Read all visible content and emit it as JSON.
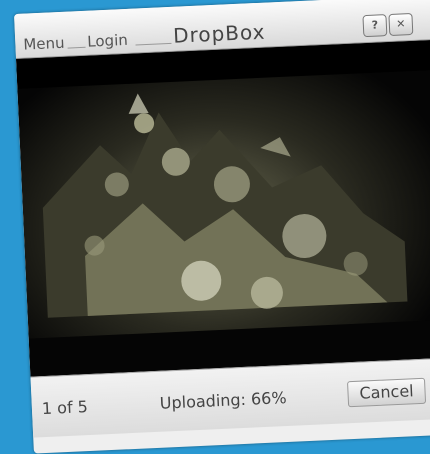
{
  "header": {
    "menu_label": "Menu",
    "login_label": "Login",
    "app_title": "DropBox",
    "help_label": "?",
    "close_label": "✕"
  },
  "status": {
    "count_text": "1 of 5",
    "upload_text": "Uploading: 66%",
    "upload_progress": 0.66,
    "cancel_label": "Cancel"
  },
  "colors": {
    "background": "#2a98d2",
    "frame": "#efefef"
  },
  "icons": {
    "help": "question-icon",
    "close": "close-icon"
  }
}
